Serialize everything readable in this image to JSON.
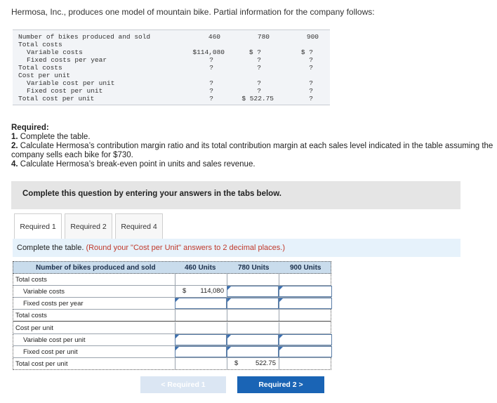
{
  "intro": "Hermosa, Inc., produces one model of mountain bike. Partial information for the company follows:",
  "given": {
    "rows": [
      {
        "label": "Number of bikes produced and sold",
        "c1": "460",
        "c2": "780",
        "c3": "900"
      },
      {
        "label": "Total costs",
        "c1": "",
        "c2": "",
        "c3": ""
      },
      {
        "label": "Variable costs",
        "c1": "$114,080",
        "c2": "$  ?",
        "c3": "$  ?"
      },
      {
        "label": "Fixed costs per year",
        "c1": "?",
        "c2": "?",
        "c3": "?"
      },
      {
        "label": "Total costs",
        "c1": "?",
        "c2": "?",
        "c3": "?"
      },
      {
        "label": "Cost per unit",
        "c1": "",
        "c2": "",
        "c3": ""
      },
      {
        "label": "Variable cost per unit",
        "c1": "?",
        "c2": "?",
        "c3": "?"
      },
      {
        "label": "Fixed cost per unit",
        "c1": "?",
        "c2": "?",
        "c3": "?"
      },
      {
        "label": "Total cost per unit",
        "c1": "?",
        "c2": "$ 522.75",
        "c3": "?"
      }
    ]
  },
  "required": {
    "heading": "Required:",
    "item1_num": "1.",
    "item1_text": " Complete the table.",
    "item2_num": "2.",
    "item2_text": " Calculate Hermosa’s contribution margin ratio and its total contribution margin at each sales level indicated in the table assuming the company sells each bike for $730.",
    "item4_num": "4.",
    "item4_text": " Calculate Hermosa’s break-even point in units and sales revenue."
  },
  "banner": "Complete this question by entering your answers in the tabs below.",
  "tabs": [
    "Required 1",
    "Required 2",
    "Required 4"
  ],
  "instruction": {
    "main": "Complete the table. ",
    "note": "(Round your \"Cost per Unit\" answers to 2 decimal places.)"
  },
  "answer_table": {
    "headers": [
      "Number of bikes produced and sold",
      "460 Units",
      "780 Units",
      "900 Units"
    ],
    "rows": [
      {
        "label": "Total costs"
      },
      {
        "label": "Variable costs",
        "c1_dollar": "$",
        "c1_value": "114,080"
      },
      {
        "label": "Fixed costs per year"
      },
      {
        "label": "Total costs"
      },
      {
        "label": "Cost per unit"
      },
      {
        "label": "Variable cost per unit"
      },
      {
        "label": "Fixed cost per unit"
      },
      {
        "label": "Total cost per unit",
        "c2_dollar": "$",
        "c2_value": "522.75"
      }
    ]
  },
  "buttons": {
    "prev": "< Required 1",
    "next": "Required 2  >"
  }
}
